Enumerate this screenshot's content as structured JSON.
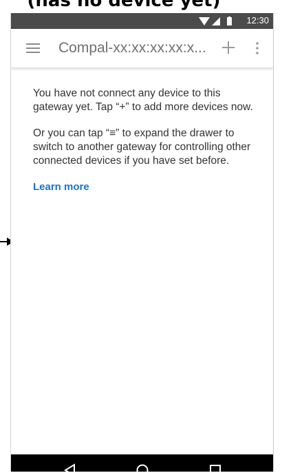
{
  "heading": "(has no device yet)",
  "status": {
    "time": "12:30",
    "icons": [
      "wifi-icon",
      "signal-icon",
      "battery-icon"
    ]
  },
  "toolbar": {
    "title": "Compal-xx:xx:xx:xx:x...",
    "menu_icon": "menu-icon",
    "add_icon": "add-icon",
    "more_icon": "more-vert-icon"
  },
  "content": {
    "paragraph1": "You have not connect any device to this gateway yet. Tap “+” to add more devices now.",
    "paragraph2": "Or you can tap “≡” to expand the drawer to switch to another gateway for controlling other connected devices if you have set before.",
    "learn_more": "Learn more"
  },
  "navbar": {
    "buttons": [
      "back-icon",
      "home-icon",
      "recents-icon"
    ]
  },
  "colors": {
    "status_bar": "#4b4b4b",
    "link": "#1a73c8",
    "nav_bar": "#000000"
  }
}
